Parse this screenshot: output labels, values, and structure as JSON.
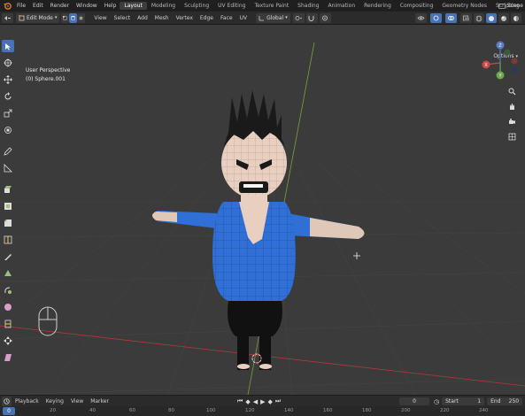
{
  "topbar": {
    "menus": [
      "File",
      "Edit",
      "Render",
      "Window",
      "Help"
    ],
    "workspaces": [
      "Layout",
      "Modeling",
      "Sculpting",
      "UV Editing",
      "Texture Paint",
      "Shading",
      "Animation",
      "Rendering",
      "Compositing",
      "Geometry Nodes",
      "Scripting"
    ],
    "active_workspace": "Layout",
    "add_tab": "+",
    "scene_label": "Scene"
  },
  "header": {
    "mode": "Edit Mode",
    "menus": [
      "View",
      "Select",
      "Add",
      "Mesh",
      "Vertex",
      "Edge",
      "Face",
      "UV"
    ],
    "transform_orientation": "Global"
  },
  "viewport": {
    "perspective": "User Perspective",
    "object": "(0) Sphere.001",
    "options_label": "Options",
    "gizmo": {
      "x_label": "X",
      "y_label": "Y",
      "z_label": "Z"
    }
  },
  "timeline": {
    "menus": [
      "Playback",
      "Keying",
      "View",
      "Marker"
    ],
    "current_frame": "0",
    "start_label": "Start",
    "start_value": "1",
    "end_label": "End",
    "end_value": "250",
    "ruler_ticks": [
      "20",
      "40",
      "60",
      "80",
      "100",
      "120",
      "140",
      "160",
      "180",
      "200",
      "220",
      "240"
    ],
    "ruler_start": "0"
  },
  "colors": {
    "accent": "#4772b3",
    "character_shirt": "#2f6fd6",
    "character_skin": "#e8cfc0",
    "character_hair": "#1a1a1a",
    "x_axis": "#b03a3a",
    "y_axis": "#7aa03a"
  }
}
